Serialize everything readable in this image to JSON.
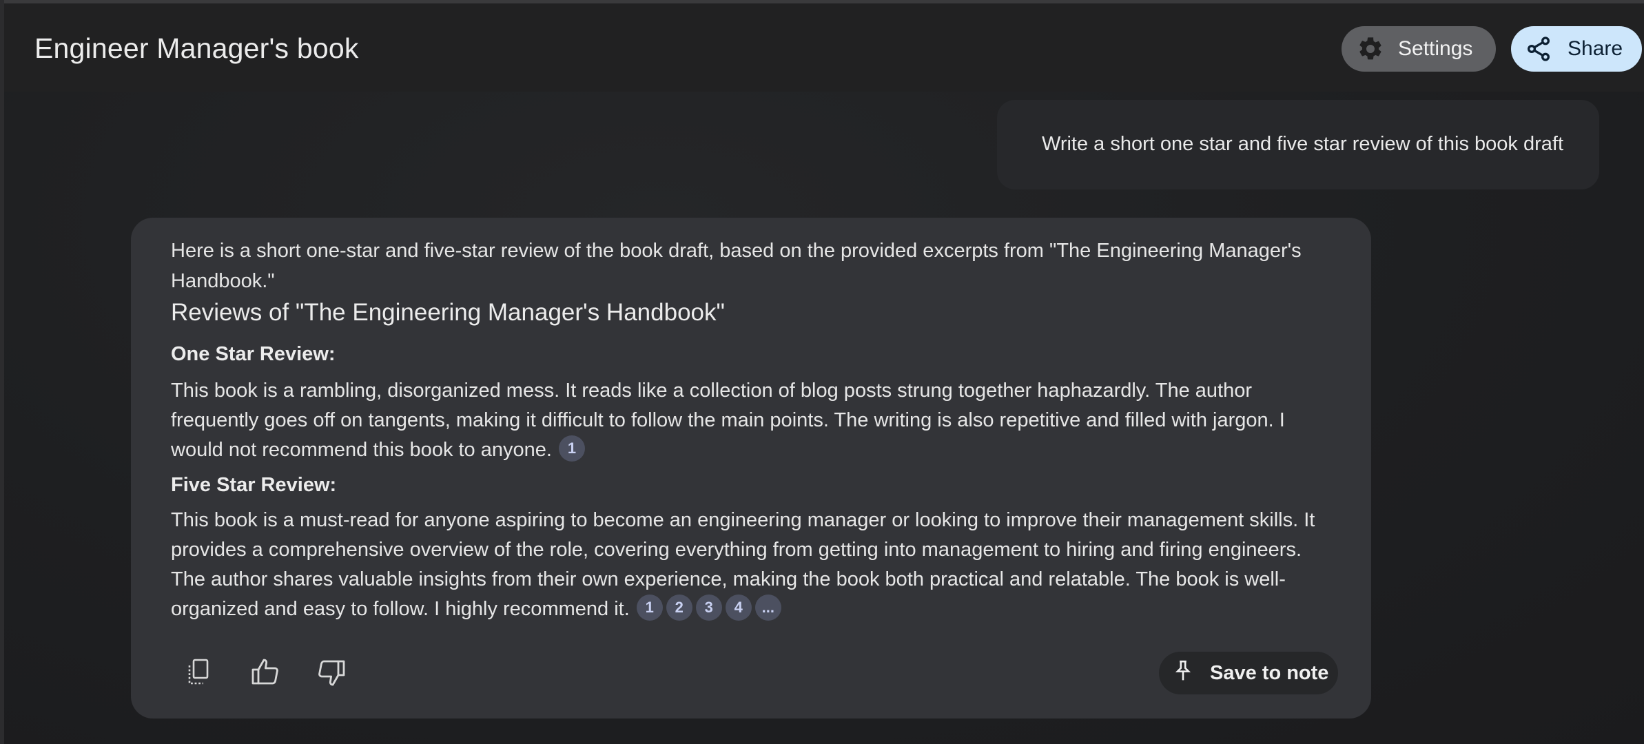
{
  "header": {
    "title": "Engineer Manager's book",
    "settings_label": "Settings",
    "share_label": "Share"
  },
  "user_message": {
    "text": "Write a short one star and five star review of this book draft"
  },
  "response": {
    "intro": "Here is a short one-star and five-star review of the book draft, based on the provided excerpts from \"The Engineering Manager's Handbook.\"",
    "heading": "Reviews of \"The Engineering Manager's Handbook\"",
    "one_star": {
      "label": "One Star Review:",
      "text": "This book is a rambling, disorganized mess. It reads like a collection of blog posts strung together haphazardly. The author frequently goes off on tangents, making it difficult to follow the main points. The writing is also repetitive and filled with jargon. I would not recommend this book to anyone.",
      "citations": [
        "1"
      ]
    },
    "five_star": {
      "label": "Five Star Review:",
      "text": "This book is a must-read for anyone aspiring to become an engineering manager or looking to improve their management skills. It provides a comprehensive overview of the role, covering everything from getting into management to hiring and firing engineers. The author shares valuable insights from their own experience, making the book both practical and relatable. The book is well-organized and easy to follow. I highly recommend it.",
      "citations": [
        "1",
        "2",
        "3",
        "4",
        "..."
      ]
    },
    "save_label": "Save to note"
  },
  "icons": {
    "settings": "gear-icon",
    "share": "share-icon",
    "copy": "copy-icon",
    "thumbs_up": "thumbs-up-icon",
    "thumbs_down": "thumbs-down-icon",
    "pin": "pin-icon"
  },
  "colors": {
    "background": "#1f1f20",
    "response_card": "#333438",
    "share_button": "#cde6fb",
    "settings_button": "#5f6063",
    "citation_chip": "#4c5060"
  }
}
